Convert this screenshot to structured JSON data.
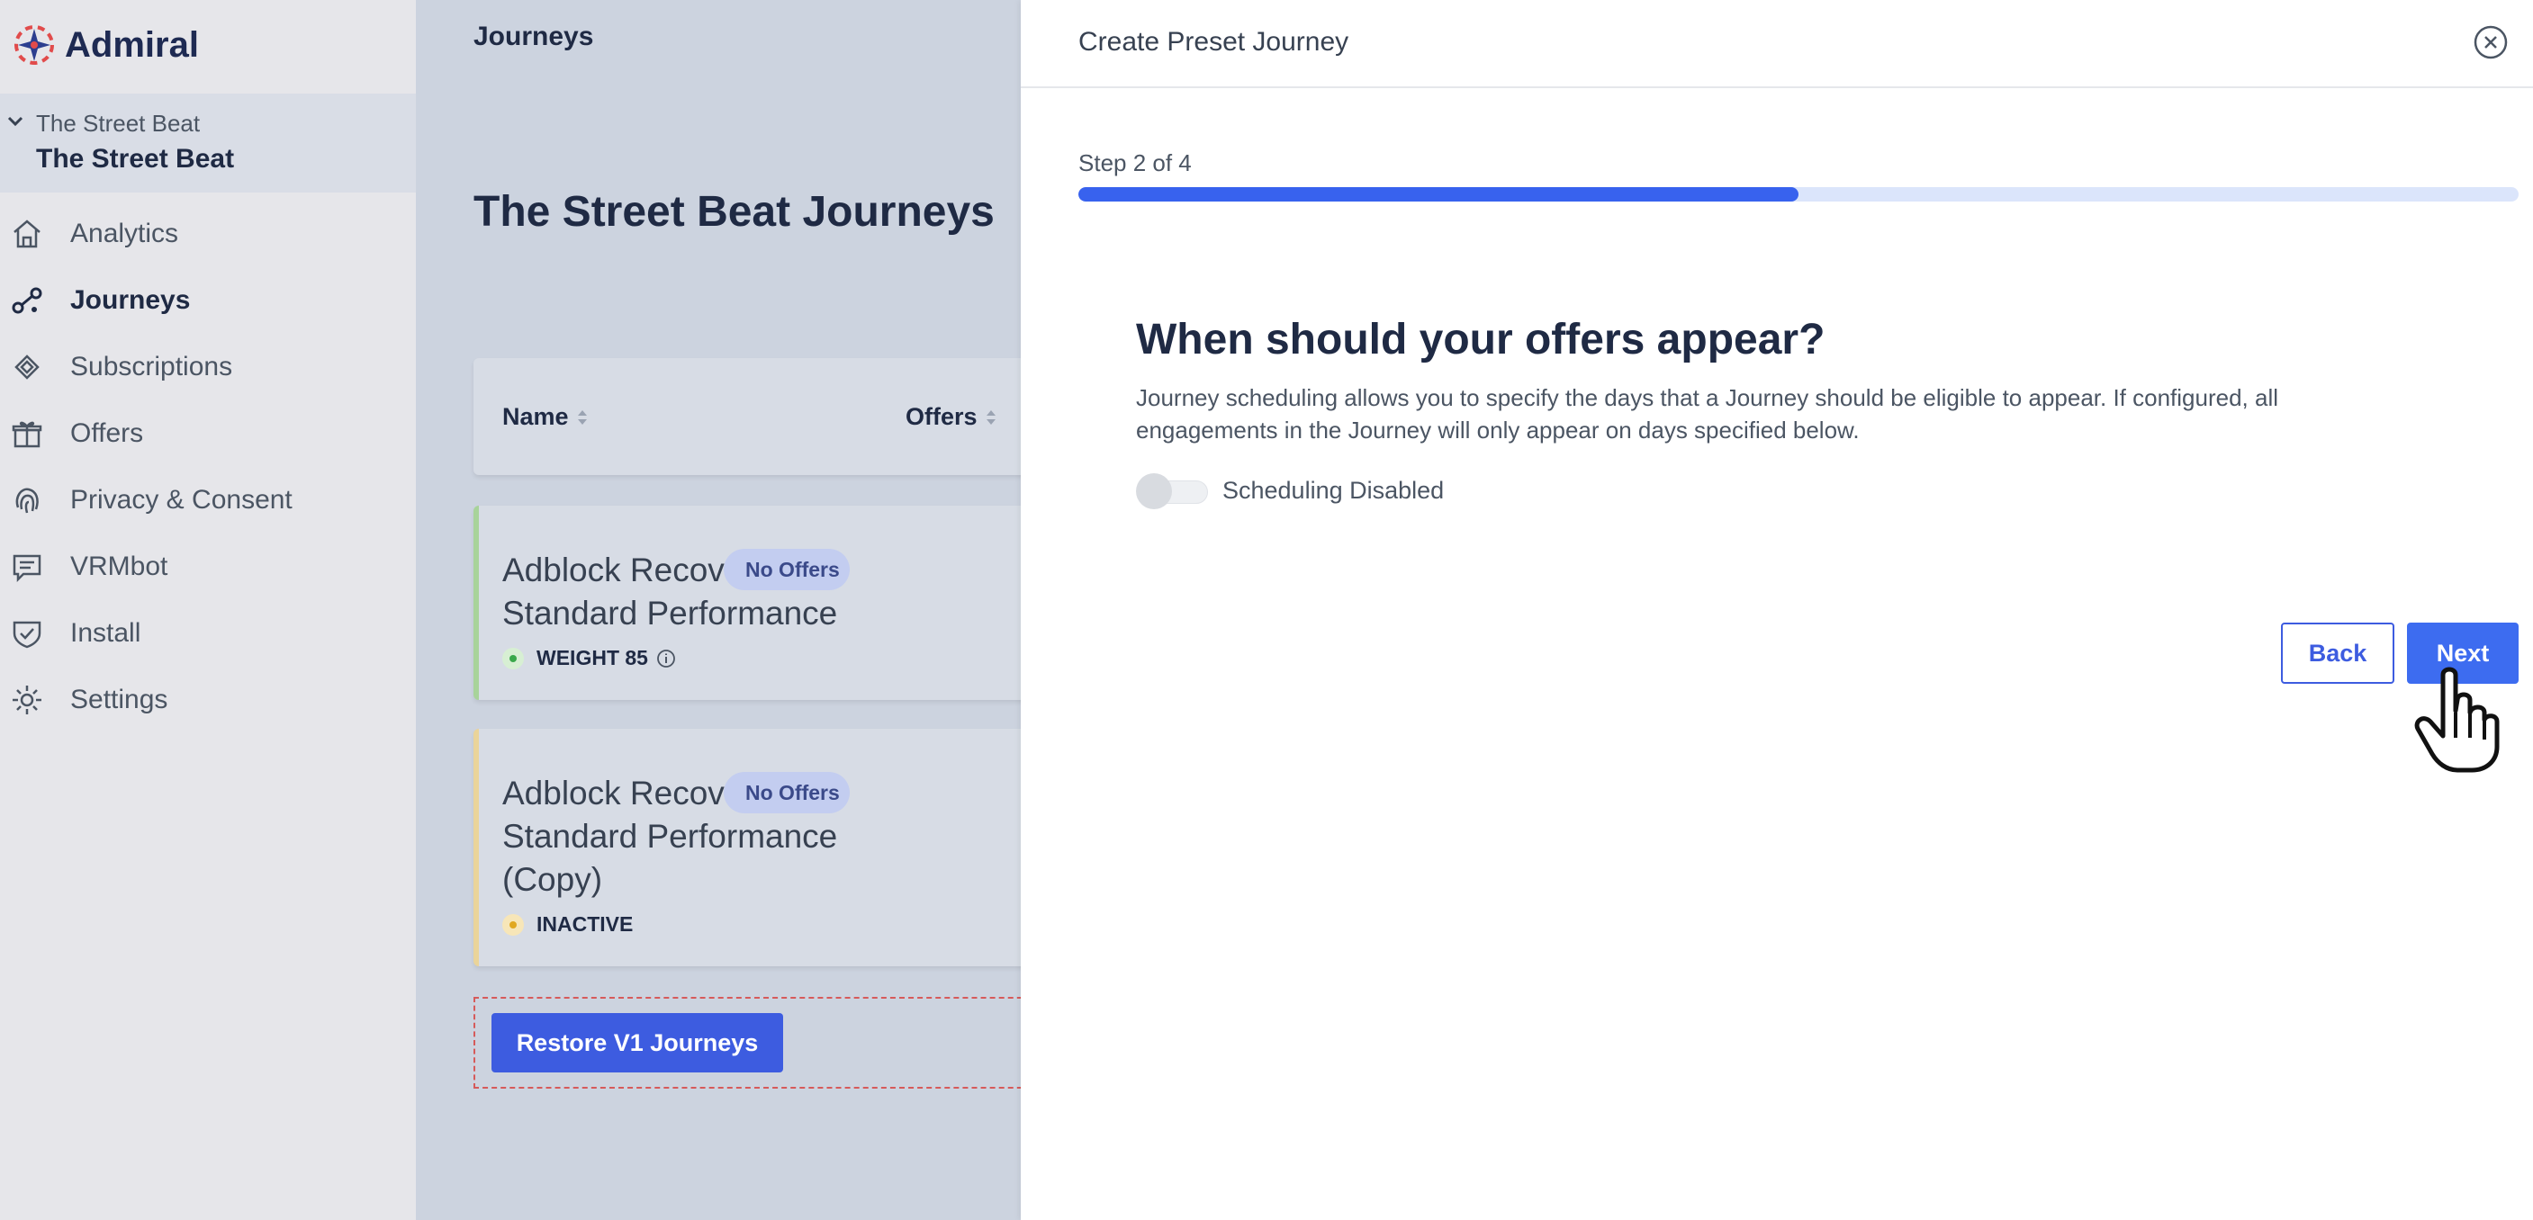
{
  "brand": {
    "name": "Admiral",
    "icon": "admiral-logo"
  },
  "site": {
    "selector_small": "The Street Beat",
    "selector_big": "The Street Beat"
  },
  "nav": [
    {
      "label": "Analytics",
      "icon": "home-icon",
      "active": false
    },
    {
      "label": "Journeys",
      "icon": "journeys-icon",
      "active": true
    },
    {
      "label": "Subscriptions",
      "icon": "subscriptions-icon",
      "active": false
    },
    {
      "label": "Offers",
      "icon": "gift-icon",
      "active": false
    },
    {
      "label": "Privacy & Consent",
      "icon": "fingerprint-icon",
      "active": false
    },
    {
      "label": "VRMbot",
      "icon": "chat-icon",
      "active": false
    },
    {
      "label": "Install",
      "icon": "shield-icon",
      "active": false
    },
    {
      "label": "Settings",
      "icon": "gear-icon",
      "active": false
    }
  ],
  "main": {
    "section_title": "Journeys",
    "page_title": "The Street Beat Journeys",
    "columns": [
      "Name",
      "Offers"
    ],
    "rows": [
      {
        "title_lines": [
          "Adblock Recovery",
          "Standard Performance"
        ],
        "offers": "No Offers",
        "status": "WEIGHT 85",
        "status_color": "#3aa84b"
      },
      {
        "title_lines": [
          "Adblock Recovery",
          "Standard Performance",
          "(Copy)"
        ],
        "offers": "No Offers",
        "status": "INACTIVE",
        "status_color": "#e0a820"
      }
    ],
    "restore_label": "Restore V1 Journeys"
  },
  "drawer": {
    "title": "Create Preset Journey",
    "step_label": "Step 2 of 4",
    "progress": 0.5,
    "question": "When should your offers appear?",
    "description": "Journey scheduling allows you to specify the days that a Journey should be eligible to appear. If configured, all engagements in the Journey will only appear on days specified below.",
    "toggle_label": "Scheduling Disabled",
    "toggle_on": false,
    "back_label": "Back",
    "next_label": "Next"
  },
  "colors": {
    "accent": "#3d5ce0",
    "progress": "#3862ee",
    "sidebar": "#e6e6ea"
  }
}
